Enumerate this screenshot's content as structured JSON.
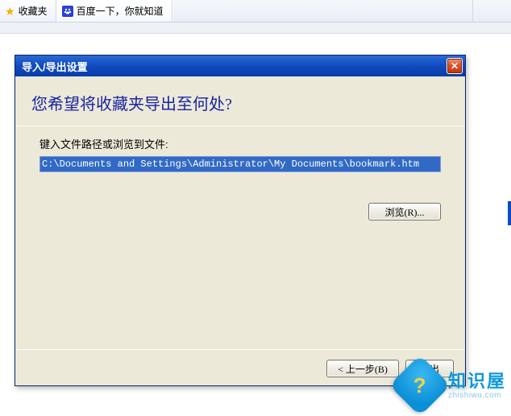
{
  "toolbar": {
    "favorites_label": "收藏夹",
    "tab_label": "百度一下，你就知道"
  },
  "dialog": {
    "title": "导入/导出设置",
    "question": "您希望将收藏夹导出至何处?",
    "field_label": "键入文件路径或浏览到文件:",
    "path_value": "C:\\Documents and Settings\\Administrator\\My Documents\\bookmark.htm",
    "browse_label": "浏览(R)...",
    "back_label": "< 上一步(B)",
    "export_label": "导出",
    "close_tooltip": "关闭"
  },
  "watermark": {
    "glyph": "?",
    "name_zh": "知识屋",
    "name_en": "zhishiwu.com"
  }
}
